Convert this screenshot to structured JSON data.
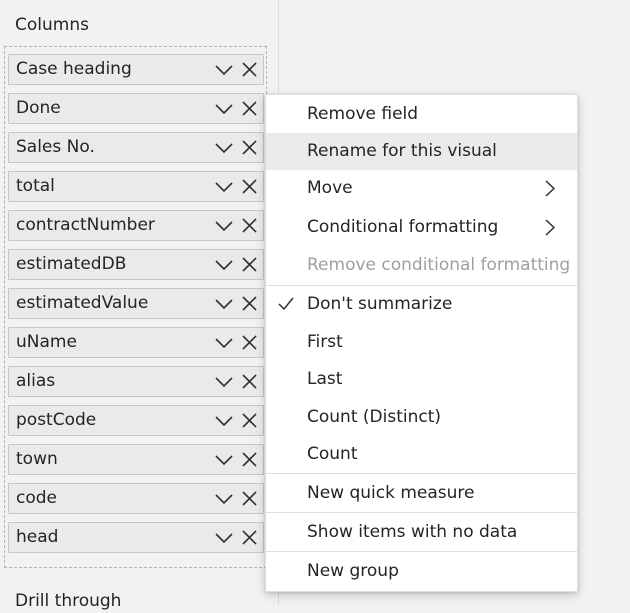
{
  "fields_pane": {
    "section_title": "Columns",
    "fields": [
      {
        "label": "Case heading"
      },
      {
        "label": "Done"
      },
      {
        "label": "Sales No."
      },
      {
        "label": "total"
      },
      {
        "label": "contractNumber"
      },
      {
        "label": "estimatedDB"
      },
      {
        "label": "estimatedValue"
      },
      {
        "label": "uName"
      },
      {
        "label": "alias"
      },
      {
        "label": "postCode"
      },
      {
        "label": "town"
      },
      {
        "label": "code"
      },
      {
        "label": "head"
      }
    ],
    "field_icons": [
      "chevron-down-icon",
      "close-icon"
    ],
    "next_section_title": "Drill through"
  },
  "context_menu": {
    "items": [
      {
        "label": "Remove field"
      },
      {
        "label": "Rename for this visual",
        "state": "hovered"
      },
      {
        "label": "Move",
        "icon": "chevron-right-icon"
      },
      {
        "label": "Conditional formatting",
        "icon": "chevron-right-icon"
      },
      {
        "label": "Remove conditional formatting",
        "state": "disabled"
      },
      {
        "label": "Don't summarize",
        "icon": "checkmark-icon",
        "state": "checked"
      },
      {
        "label": "First"
      },
      {
        "label": "Last"
      },
      {
        "label": "Count (Distinct)"
      },
      {
        "label": "Count"
      },
      {
        "label": "New quick measure"
      },
      {
        "label": "Show items with no data"
      },
      {
        "label": "New group"
      }
    ]
  },
  "colors": {
    "pane_background": "#f3f2f1",
    "pill_background": "#eaeaea",
    "menu_background": "#ffffff",
    "hover_background": "#edebe9",
    "text": "#252423",
    "disabled_text": "#a19f9d"
  }
}
